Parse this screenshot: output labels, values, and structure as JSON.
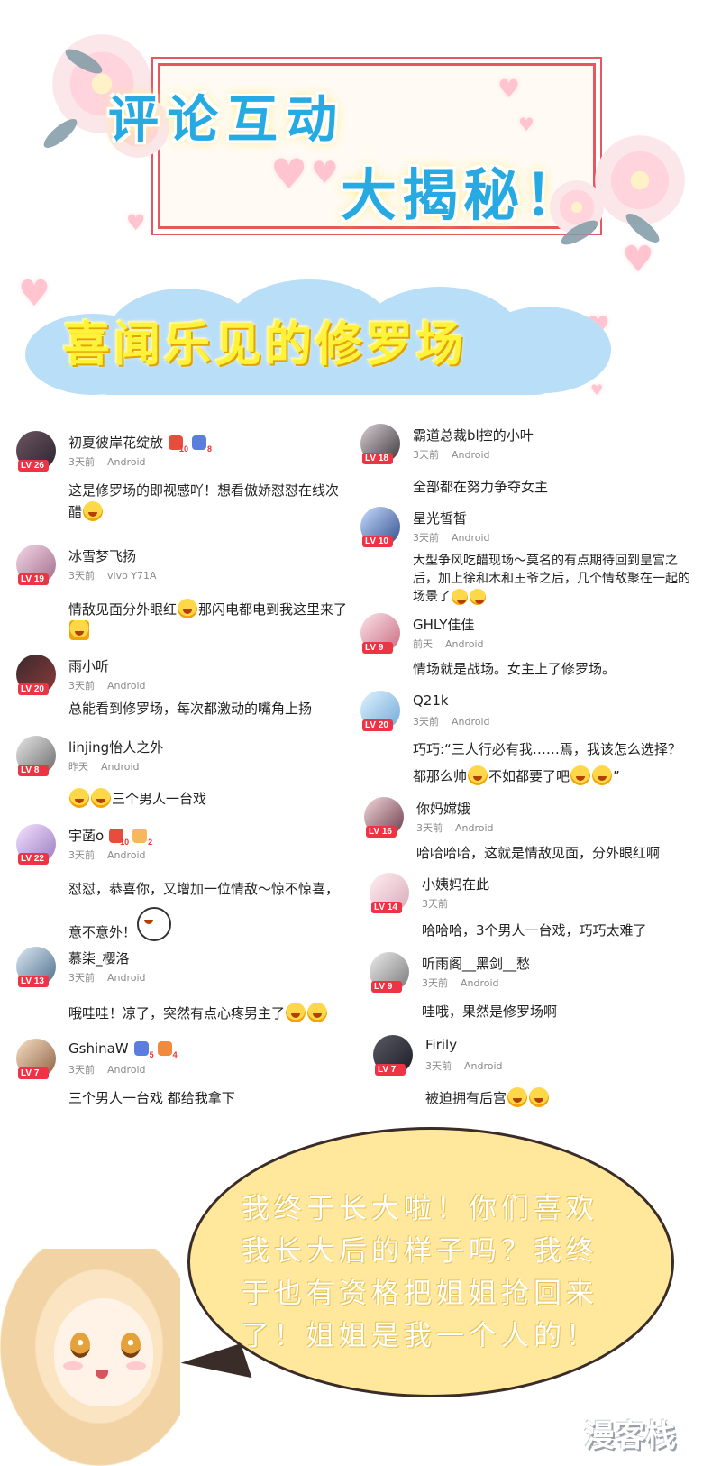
{
  "header": {
    "title_line1": "评论互动",
    "title_line2": "大揭秘！"
  },
  "section": {
    "title": "喜闻乐见的修罗场"
  },
  "colors": {
    "title_blue": "#27a9e1",
    "frame_red": "#e8565f",
    "cloud_blue": "#b9def7",
    "section_yellow": "#fff33a",
    "level_red": "#ee3344",
    "bubble_yellow": "#ffe89c"
  },
  "comments_left": [
    {
      "user": "初夏彼岸花绽放",
      "level": "LV 26",
      "time": "3天前",
      "device": "Android",
      "badges": [
        "10",
        "8"
      ],
      "text": "这是修罗场的即视感吖！想看傲娇怼怼在线次醋",
      "emoji": 1
    },
    {
      "user": "冰雪梦飞扬",
      "level": "LV 19",
      "time": "3天前",
      "device": "vivo Y71A",
      "badges": [],
      "text": "情敌见面分外眼红",
      "text_b": "那闪电都电到我这里来了",
      "emoji": 1
    },
    {
      "user": "雨小听",
      "level": "LV 20",
      "time": "3天前",
      "device": "Android",
      "badges": [],
      "text": "总能看到修罗场，每次都激动的嘴角上扬",
      "emoji": 0
    },
    {
      "user": "linjing怡人之外",
      "level": "LV 8",
      "time": "昨天",
      "device": "Android",
      "badges": [],
      "text": "三个男人一台戏",
      "emoji": 2
    },
    {
      "user": "宇菡o",
      "level": "LV 22",
      "time": "3天前",
      "device": "Android",
      "badges": [
        "10",
        "2"
      ],
      "text": "怼怼，恭喜你，又增加一位情敌～惊不惊喜，意不意外！",
      "emoji": 0
    },
    {
      "user": "慕柒_樱洛",
      "level": "LV 13",
      "time": "3天前",
      "device": "Android",
      "badges": [],
      "text": "哦哇哇！凉了，突然有点心疼男主了",
      "emoji": 2
    },
    {
      "user": "GshinaW",
      "level": "LV 7",
      "time": "3天前",
      "device": "Android",
      "badges": [
        "5",
        "4"
      ],
      "text": "三个男人一台戏 都给我拿下",
      "emoji": 0
    }
  ],
  "comments_right": [
    {
      "user": "霸道总裁bl控的小叶",
      "level": "LV 18",
      "time": "3天前",
      "device": "Android",
      "text": "全部都在努力争夺女主",
      "emoji": 0
    },
    {
      "user": "星光皙皙",
      "level": "LV 10",
      "time": "3天前",
      "device": "Android",
      "text": "大型争风吃醋现场～莫名的有点期待回到皇宫之后，加上徐和木和王爷之后，几个情敌聚在一起的场景了",
      "emoji": 2
    },
    {
      "user": "GHLY佳佳",
      "level": "LV 9",
      "time": "前天",
      "device": "Android",
      "text": "情场就是战场。女主上了修罗场。",
      "emoji": 0
    },
    {
      "user": "Q21k",
      "level": "LV 20",
      "time": "3天前",
      "device": "Android",
      "text": "巧巧:“三人行必有我……焉，我该怎么选择？都那么帅",
      "text_b": "不如都要了吧",
      "text_c": "”",
      "emoji": 2
    },
    {
      "user": "你妈嫦娥",
      "level": "LV 16",
      "time": "3天前",
      "device": "Android",
      "text": "哈哈哈哈，这就是情敌见面，分外眼红啊",
      "emoji": 0
    },
    {
      "user": "小姨妈在此",
      "level": "LV 14",
      "time": "3天前",
      "device": "",
      "text": "哈哈哈，3个男人一台戏，巧巧太难了",
      "emoji": 0
    },
    {
      "user": "听雨阁__黑剑__愁",
      "level": "LV 9",
      "time": "3天前",
      "device": "Android",
      "text": "哇哦，果然是修罗场啊",
      "emoji": 0
    },
    {
      "user": "Firily",
      "level": "LV 7",
      "time": "3天前",
      "device": "Android",
      "text": "被迫拥有后宫",
      "emoji": 2
    }
  ],
  "bubble": {
    "text": "我终于长大啦！你们喜欢我长大后的样子吗？我终于也有资格把姐姐抢回来了！姐姐是我一个人的！"
  },
  "logo": {
    "text": "漫客栈"
  }
}
